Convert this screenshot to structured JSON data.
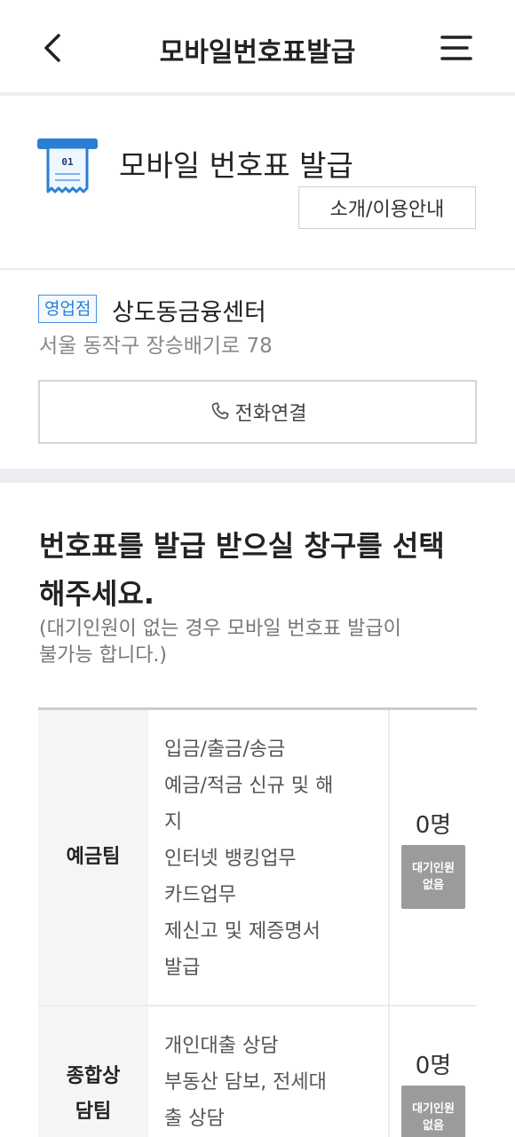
{
  "header": {
    "title": "모바일번호표발급",
    "back_icon": "chevron-left-icon",
    "menu_icon": "hamburger-menu-icon"
  },
  "service": {
    "ticket_icon_label": "01",
    "title": "모바일 번호표 발급",
    "guide_button": "소개/이용안내"
  },
  "branch": {
    "type_badge": "영업점",
    "name": "상도동금융센터",
    "address": "서울 동작구 장승배기로 78",
    "call_button": "전화연결"
  },
  "selection": {
    "question_line1": "번호표를 발급 받으실 창구를 선택",
    "question_line2": "해주세요.",
    "note_line1": "(대기인원이 없는 경우 모바일 번호표 발급이",
    "note_line2": "불가능 합니다.)"
  },
  "counters": [
    {
      "team": "예금팀",
      "tasks": [
        "입금/출금/송금",
        "예금/적금 신규 및 해",
        "지",
        "인터넷 뱅킹업무",
        "카드업무",
        "제신고 및 제증명서",
        "발급"
      ],
      "waiting_count": "0명",
      "status_line1": "대기인원",
      "status_line2": "없음"
    },
    {
      "team_line1": "종합상",
      "team_line2": "담팀",
      "tasks": [
        "개인대출 상담",
        "부동산 담보, 전세대",
        "출 상담"
      ],
      "waiting_count": "0명",
      "status_line1": "대기인원",
      "status_line2": "없음"
    }
  ],
  "colors": {
    "accent_blue": "#2a7fd4",
    "badge_gray": "#9b9b9b",
    "divider": "#eceef1"
  }
}
